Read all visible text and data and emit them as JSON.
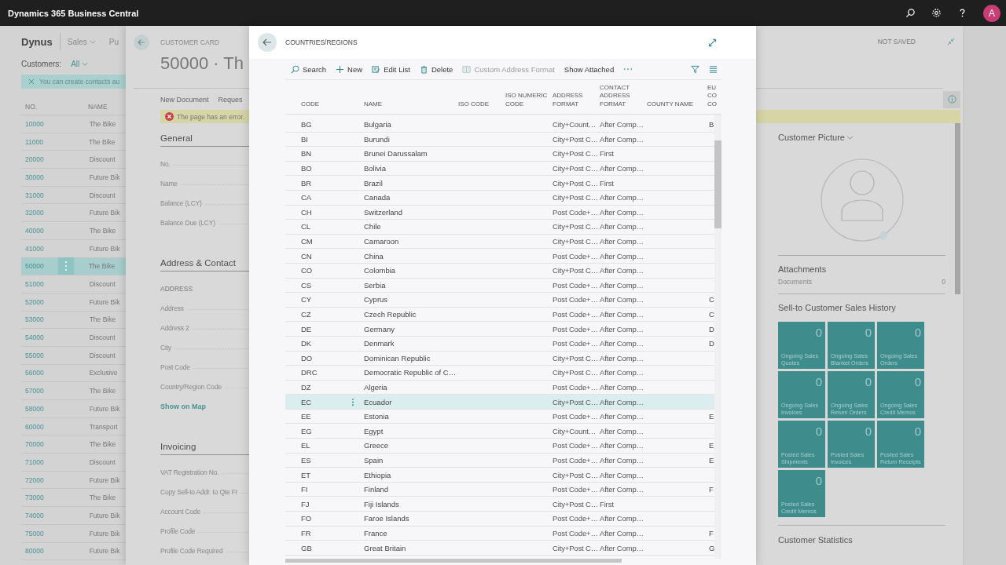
{
  "top_bar": {
    "title": "Dynamics 365 Business Central",
    "avatar": "A"
  },
  "customer_list": {
    "company": "Dynus",
    "nav": [
      "Sales",
      "Pu"
    ],
    "filter_label": "Customers:",
    "filter_value": "All",
    "notice": "You can create contacts au",
    "columns": [
      "NO.",
      "NAME"
    ],
    "rows": [
      {
        "no": "10000",
        "name": "The Bike",
        "selected": false
      },
      {
        "no": "11000",
        "name": "The Bike",
        "selected": false
      },
      {
        "no": "20000",
        "name": "Discount",
        "selected": false
      },
      {
        "no": "30000",
        "name": "Future Bik",
        "selected": false
      },
      {
        "no": "31000",
        "name": "Discount",
        "selected": false
      },
      {
        "no": "32000",
        "name": "Future Bik",
        "selected": false
      },
      {
        "no": "40000",
        "name": "The Bike",
        "selected": false
      },
      {
        "no": "41000",
        "name": "Future Bik",
        "selected": false
      },
      {
        "no": "50000",
        "name": "The Bike",
        "selected": true
      },
      {
        "no": "51000",
        "name": "Discount",
        "selected": false
      },
      {
        "no": "52000",
        "name": "Future Bik",
        "selected": false
      },
      {
        "no": "53000",
        "name": "The Bike",
        "selected": false
      },
      {
        "no": "54000",
        "name": "Discount",
        "selected": false
      },
      {
        "no": "55000",
        "name": "Discount",
        "selected": false
      },
      {
        "no": "56000",
        "name": "Exclusive",
        "selected": false
      },
      {
        "no": "57000",
        "name": "The Bike",
        "selected": false
      },
      {
        "no": "58000",
        "name": "Future Bik",
        "selected": false
      },
      {
        "no": "60000",
        "name": "Transport",
        "selected": false
      },
      {
        "no": "70000",
        "name": "The Bike",
        "selected": false
      },
      {
        "no": "71000",
        "name": "Discount",
        "selected": false
      },
      {
        "no": "72000",
        "name": "Future Bik",
        "selected": false
      },
      {
        "no": "73000",
        "name": "The Bike",
        "selected": false
      },
      {
        "no": "74000",
        "name": "Future Bik",
        "selected": false
      },
      {
        "no": "75000",
        "name": "Future Bik",
        "selected": false
      },
      {
        "no": "80000",
        "name": "Future Bik",
        "selected": false
      }
    ]
  },
  "customer_card": {
    "caption": "CUSTOMER CARD",
    "title": "50000 · Th",
    "status": "NOT SAVED",
    "actions": [
      "New Document",
      "Reques"
    ],
    "error": "The page has an error.",
    "sections": [
      {
        "title": "General",
        "fields": [
          "No.",
          "Name",
          "Balance (LCY)",
          "Balance Due (LCY)"
        ]
      },
      {
        "title": "Address & Contact",
        "subheading": "ADDRESS",
        "fields": [
          "Address",
          "Address 2",
          "City",
          "Post Code",
          "Country/Region Code"
        ],
        "link": "Show on Map"
      },
      {
        "title": "Invoicing",
        "fields": [
          "VAT Registration No.",
          "Copy Sell-to Addr. to Qte Fr",
          "Account Code",
          "Profile Code",
          "Profile Code Required"
        ]
      }
    ],
    "factbox": {
      "picture_title": "Customer Picture",
      "attachments_title": "Attachments",
      "documents_label": "Documents",
      "documents_count": "0",
      "history_title": "Sell-to Customer Sales History",
      "tiles": [
        {
          "count": "0",
          "label": "Ongoing Sales Quotes"
        },
        {
          "count": "0",
          "label": "Ongoing Sales Blanket Orders"
        },
        {
          "count": "0",
          "label": "Ongoing Sales Orders"
        },
        {
          "count": "0",
          "label": "Ongoing Sales Invoices"
        },
        {
          "count": "0",
          "label": "Ongoing Sales Return Orders"
        },
        {
          "count": "0",
          "label": "Ongoing Sales Credit Memos"
        },
        {
          "count": "0",
          "label": "Posted Sales Shipments"
        },
        {
          "count": "0",
          "label": "Posted Sales Invoices"
        },
        {
          "count": "0",
          "label": "Posted Sales Return Receipts"
        },
        {
          "count": "0",
          "label": "Posted Sales Credit Memos"
        }
      ],
      "statistics_title": "Customer Statistics"
    }
  },
  "countries_dialog": {
    "caption": "COUNTRIES/REGIONS",
    "actions": [
      {
        "label": "Search",
        "kind": "search",
        "disabled": false
      },
      {
        "label": "New",
        "kind": "new",
        "disabled": false
      },
      {
        "label": "Edit List",
        "kind": "edit",
        "disabled": false
      },
      {
        "label": "Delete",
        "kind": "delete",
        "disabled": false
      },
      {
        "label": "Custom Address Format",
        "kind": "format",
        "disabled": true
      },
      {
        "label": "Show Attached",
        "kind": "plain",
        "disabled": false
      }
    ],
    "columns": [
      "CODE",
      "NAME",
      "ISO CODE",
      "ISO NUMERIC CODE",
      "ADDRESS FORMAT",
      "CONTACT ADDRESS FORMAT",
      "COUNTY NAME",
      "EU CO CO"
    ],
    "rows": [
      {
        "code": "BG",
        "name": "Bulgaria",
        "address_format": "City+Count…",
        "contact_format": "After Comp…",
        "eu": "B",
        "selected": false
      },
      {
        "code": "BI",
        "name": "Burundi",
        "address_format": "City+Post C…",
        "contact_format": "After Comp…",
        "selected": false
      },
      {
        "code": "BN",
        "name": "Brunei Darussalam",
        "address_format": "City+Post C…",
        "contact_format": "First",
        "selected": false
      },
      {
        "code": "BO",
        "name": "Bolivia",
        "address_format": "City+Post C…",
        "contact_format": "After Comp…",
        "selected": false
      },
      {
        "code": "BR",
        "name": "Brazil",
        "address_format": "City+Post C…",
        "contact_format": "First",
        "selected": false
      },
      {
        "code": "CA",
        "name": "Canada",
        "address_format": "City+Post C…",
        "contact_format": "After Comp…",
        "selected": false
      },
      {
        "code": "CH",
        "name": "Switzerland",
        "address_format": "Post Code+…",
        "contact_format": "After Comp…",
        "selected": false
      },
      {
        "code": "CL",
        "name": "Chile",
        "address_format": "City+Post C…",
        "contact_format": "After Comp…",
        "selected": false
      },
      {
        "code": "CM",
        "name": "Camaroon",
        "address_format": "City+Post C…",
        "contact_format": "After Comp…",
        "selected": false
      },
      {
        "code": "CN",
        "name": "China",
        "address_format": "Post Code+…",
        "contact_format": "After Comp…",
        "selected": false
      },
      {
        "code": "CO",
        "name": "Colombia",
        "address_format": "City+Post C…",
        "contact_format": "After Comp…",
        "selected": false
      },
      {
        "code": "CS",
        "name": "Serbia",
        "address_format": "Post Code+…",
        "contact_format": "After Comp…",
        "selected": false
      },
      {
        "code": "CY",
        "name": "Cyprus",
        "address_format": "Post Code+…",
        "contact_format": "After Comp…",
        "eu": "C",
        "selected": false
      },
      {
        "code": "CZ",
        "name": "Czech Republic",
        "address_format": "Post Code+…",
        "contact_format": "After Comp…",
        "eu": "C",
        "selected": false
      },
      {
        "code": "DE",
        "name": "Germany",
        "address_format": "Post Code+…",
        "contact_format": "After Comp…",
        "eu": "D",
        "selected": false
      },
      {
        "code": "DK",
        "name": "Denmark",
        "address_format": "Post Code+…",
        "contact_format": "After Comp…",
        "eu": "D",
        "selected": false
      },
      {
        "code": "DO",
        "name": "Dominican Republic",
        "address_format": "City+Post C…",
        "contact_format": "After Comp…",
        "selected": false
      },
      {
        "code": "DRC",
        "name": "Democratic Republic of C…",
        "address_format": "City+Post C…",
        "contact_format": "After Comp…",
        "selected": false
      },
      {
        "code": "DZ",
        "name": "Algeria",
        "address_format": "Post Code+…",
        "contact_format": "After Comp…",
        "selected": false
      },
      {
        "code": "EC",
        "name": "Ecuador",
        "address_format": "City+Post C…",
        "contact_format": "After Comp…",
        "selected": true
      },
      {
        "code": "EE",
        "name": "Estonia",
        "address_format": "Post Code+…",
        "contact_format": "After Comp…",
        "eu": "E",
        "selected": false
      },
      {
        "code": "EG",
        "name": "Egypt",
        "address_format": "City+Count…",
        "contact_format": "After Comp…",
        "selected": false
      },
      {
        "code": "EL",
        "name": "Greece",
        "address_format": "Post Code+…",
        "contact_format": "After Comp…",
        "eu": "E",
        "selected": false
      },
      {
        "code": "ES",
        "name": "Spain",
        "address_format": "Post Code+…",
        "contact_format": "After Comp…",
        "eu": "E",
        "selected": false
      },
      {
        "code": "ET",
        "name": "Ethiopia",
        "address_format": "City+Post C…",
        "contact_format": "After Comp…",
        "selected": false
      },
      {
        "code": "FI",
        "name": "Finland",
        "address_format": "Post Code+…",
        "contact_format": "After Comp…",
        "eu": "F",
        "selected": false
      },
      {
        "code": "FJ",
        "name": "Fiji Islands",
        "address_format": "City+Post C…",
        "contact_format": "First",
        "selected": false
      },
      {
        "code": "FO",
        "name": "Faroe Islands",
        "address_format": "Post Code+…",
        "contact_format": "After Comp…",
        "selected": false
      },
      {
        "code": "FR",
        "name": "France",
        "address_format": "Post Code+…",
        "contact_format": "After Comp…",
        "eu": "F",
        "selected": false
      },
      {
        "code": "GB",
        "name": "Great Britain",
        "address_format": "City+Post C…",
        "contact_format": "After Comp…",
        "eu": "G",
        "selected": false
      }
    ]
  }
}
